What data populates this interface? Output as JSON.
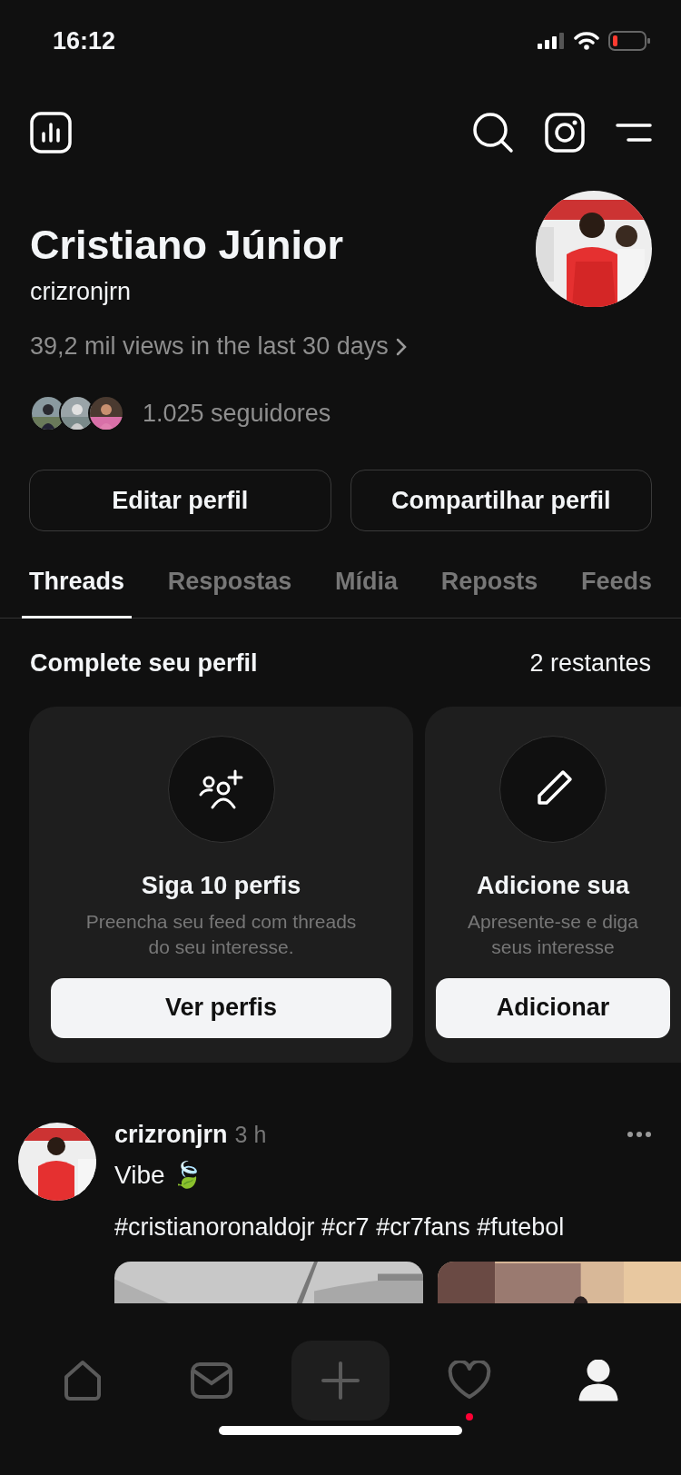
{
  "status_bar": {
    "time": "16:12"
  },
  "profile": {
    "name": "Cristiano Júnior",
    "handle": "crizronjrn",
    "views": "39,2 mil views in the last 30 days",
    "followers": "1.025 seguidores"
  },
  "buttons": [
    "Editar perfil",
    "Compartilhar perfil"
  ],
  "tabs": [
    {
      "label": "Threads",
      "selected": true
    },
    {
      "label": "Respostas",
      "selected": false
    },
    {
      "label": "Mídia",
      "selected": false
    },
    {
      "label": "Reposts",
      "selected": false
    },
    {
      "label": "Feeds",
      "selected": false
    }
  ],
  "complete_profile": {
    "title": "Complete seu perfil",
    "remaining": "2 restantes",
    "cards": [
      {
        "kind": "follow",
        "title": "Siga 10 perfis",
        "lines": [
          "Preencha seu feed com threads",
          "do seu interesse."
        ],
        "button": "Ver perfis"
      },
      {
        "kind": "edit",
        "title": "Adicione sua",
        "lines": [
          "Apresente-se e diga",
          "seus interesse"
        ],
        "button": "Adicionar"
      }
    ]
  },
  "post": {
    "author": "crizronjrn",
    "time": "3 h",
    "text": "Vibe 🍃",
    "hashtags": "#cristianoronaldojr #cr7 #cr7fans #futebol"
  },
  "nav": [
    {
      "kind": "home",
      "selected": false,
      "notification": false
    },
    {
      "kind": "inbox",
      "selected": false,
      "notification": false
    },
    {
      "kind": "compose",
      "selected": false,
      "notification": false
    },
    {
      "kind": "activity",
      "selected": false,
      "notification": true
    },
    {
      "kind": "profile",
      "selected": true,
      "notification": false
    }
  ]
}
